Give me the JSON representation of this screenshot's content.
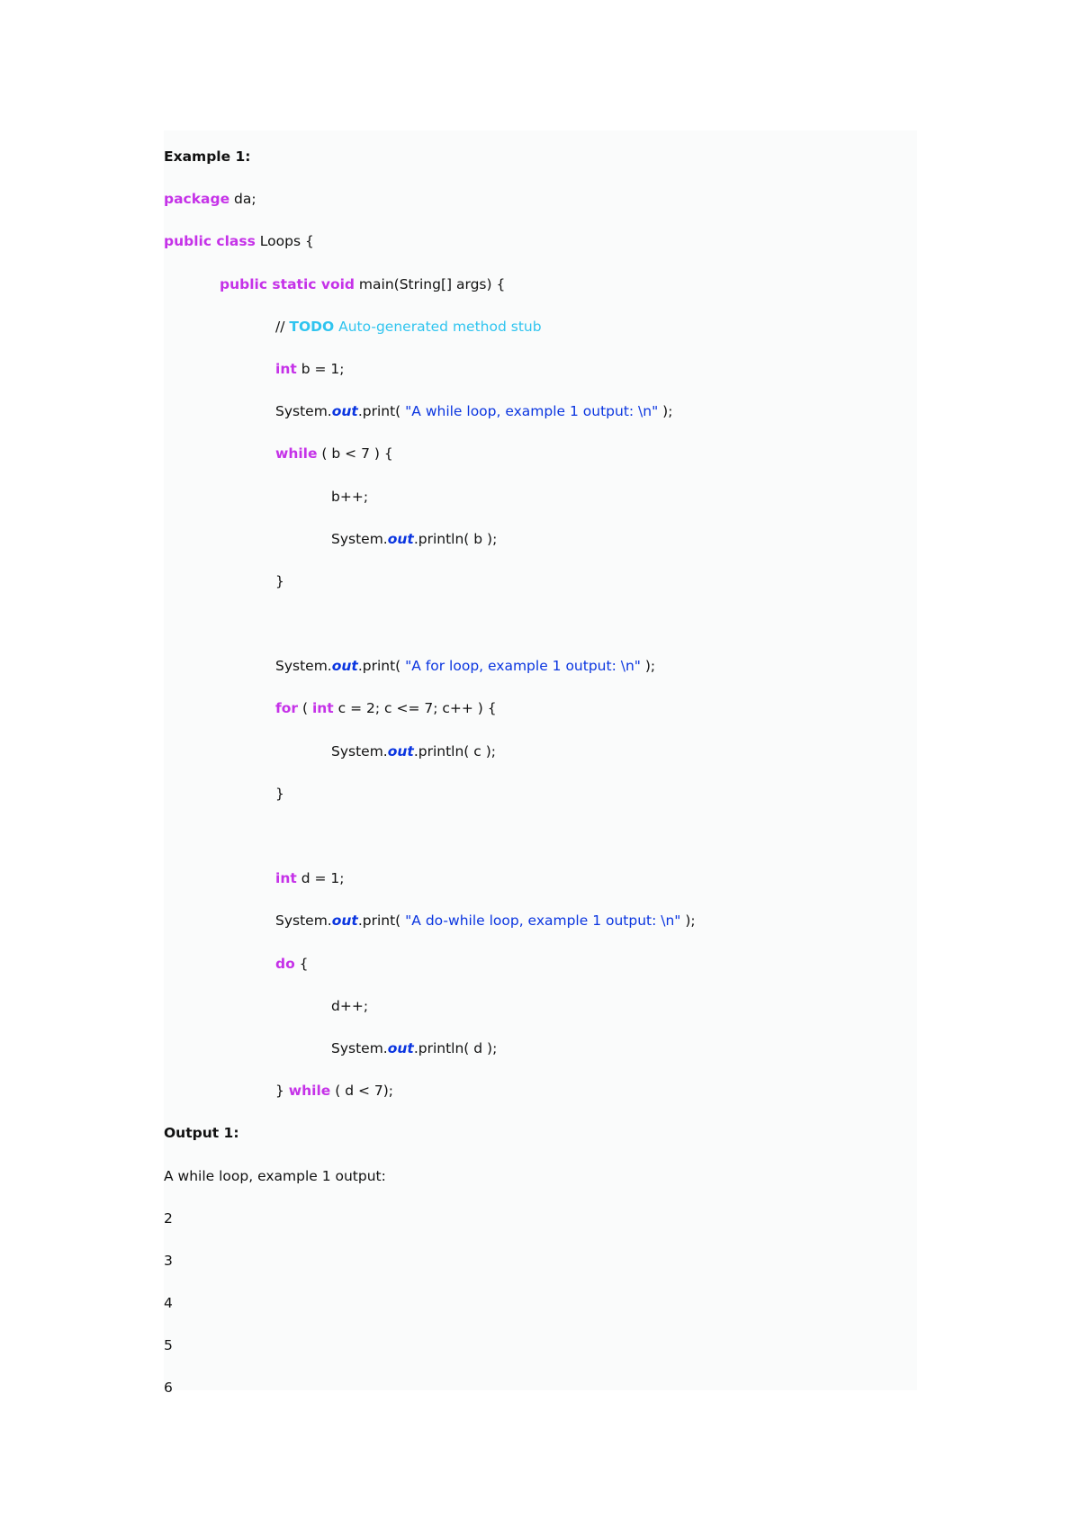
{
  "heading_example": "Example 1:",
  "code": {
    "package_kw": "package",
    "package_name": " da;",
    "class_kw": "public class",
    "class_rest": " Loops {",
    "main_kw": "public static void",
    "main_rest": " main(String[] args) {",
    "comment_slash": "// ",
    "comment_tag": "TODO",
    "comment_text": " Auto-generated method stub",
    "int_kw": "int",
    "b_decl": " b = 1;",
    "sys": "System.",
    "out": "out",
    "print_open": ".print( ",
    "println_open": ".println( ",
    "str_while": "\"A while loop, example 1 output: \\n\"",
    "str_for": "\"A for loop, example 1 output: \\n\"",
    "str_dowhile": "\"A do-while loop, example 1 output: \\n\"",
    "print_close": " );",
    "while_kw": "while",
    "while_cond": " ( b < 7 ) {",
    "b_inc": "b++;",
    "b_arg": "b );",
    "close_brace": "}",
    "for_kw": "for",
    "for_open": " ( ",
    "for_rest": " c = 2; c <= 7; c++ ) {",
    "c_arg": "c );",
    "d_decl": " d = 1;",
    "do_kw": "do",
    "do_rest": " {",
    "d_inc": "d++;",
    "d_arg": "d );",
    "dowhile_close": "} ",
    "dowhile_cond": " ( d < 7);"
  },
  "heading_output": "Output 1:",
  "output_lines": [
    "A while loop, example 1 output:",
    "2",
    "3",
    "4",
    "5",
    "6"
  ]
}
